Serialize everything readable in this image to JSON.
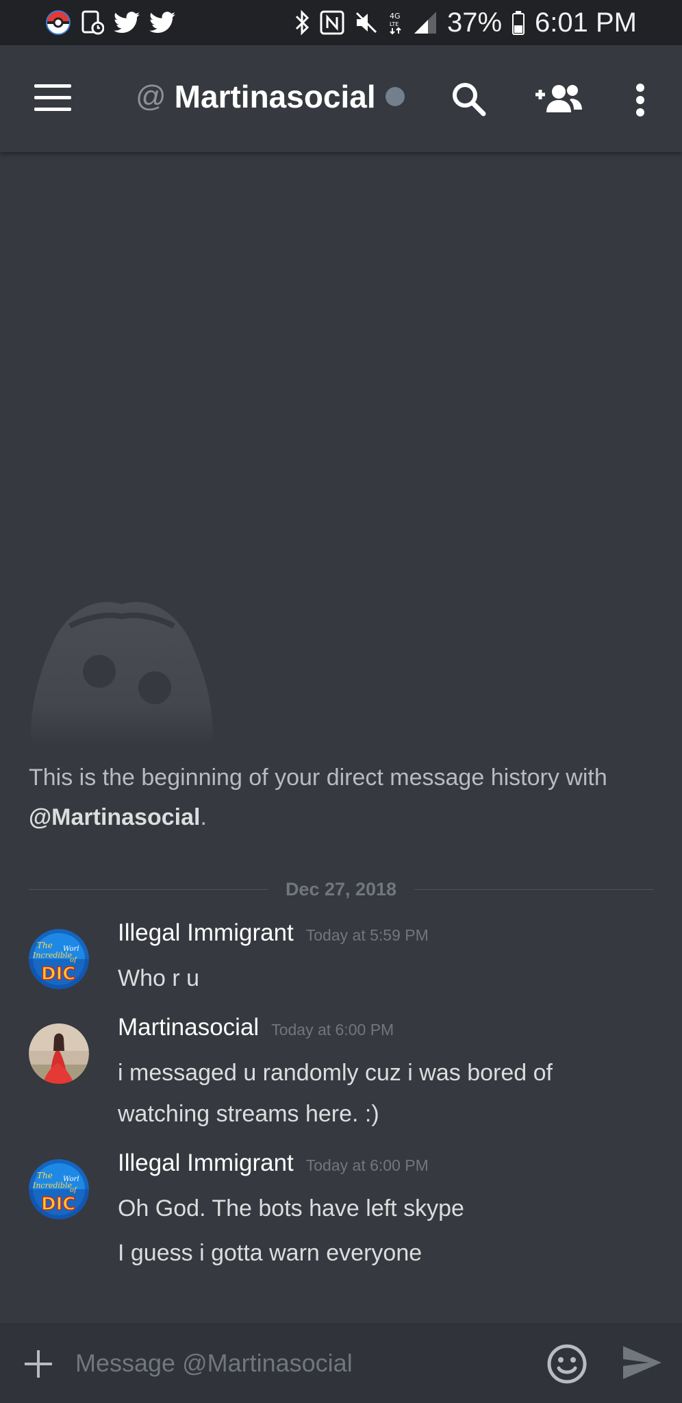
{
  "status_bar": {
    "left_icons": [
      "pokeball-icon",
      "screenshot-icon",
      "twitter-icon",
      "twitter-icon"
    ],
    "right_icons": [
      "bluetooth-icon",
      "nfc-icon",
      "mute-icon",
      "lte-icon",
      "signal-icon"
    ],
    "battery": "37%",
    "time": "6:01 PM"
  },
  "header": {
    "at_symbol": "@",
    "channel_name": "Martinasocial",
    "status": "offline",
    "status_color": "#747f8d"
  },
  "intro": {
    "text": "This is the beginning of your direct message history with ",
    "mention": "@Martinasocial",
    "suffix": "."
  },
  "divider": {
    "date": "Dec 27, 2018"
  },
  "messages": [
    {
      "author": "Illegal Immigrant",
      "timestamp": "Today at 5:59 PM",
      "avatar": "dic-logo-avatar",
      "lines": [
        "Who r u"
      ]
    },
    {
      "author": "Martinasocial",
      "timestamp": "Today at 6:00 PM",
      "avatar": "photo-avatar",
      "lines": [
        "i messaged u randomly cuz i was bored of",
        "watching streams here. :)"
      ]
    },
    {
      "author": "Illegal Immigrant",
      "timestamp": "Today at 6:00 PM",
      "avatar": "dic-logo-avatar",
      "lines": [
        "Oh God. The bots have left skype",
        "I guess i gotta warn everyone"
      ]
    }
  ],
  "composer": {
    "placeholder": "Message @Martinasocial"
  },
  "colors": {
    "background": "#36393f",
    "status_bar": "#202225",
    "composer": "#303339",
    "text_muted": "#72767d"
  }
}
